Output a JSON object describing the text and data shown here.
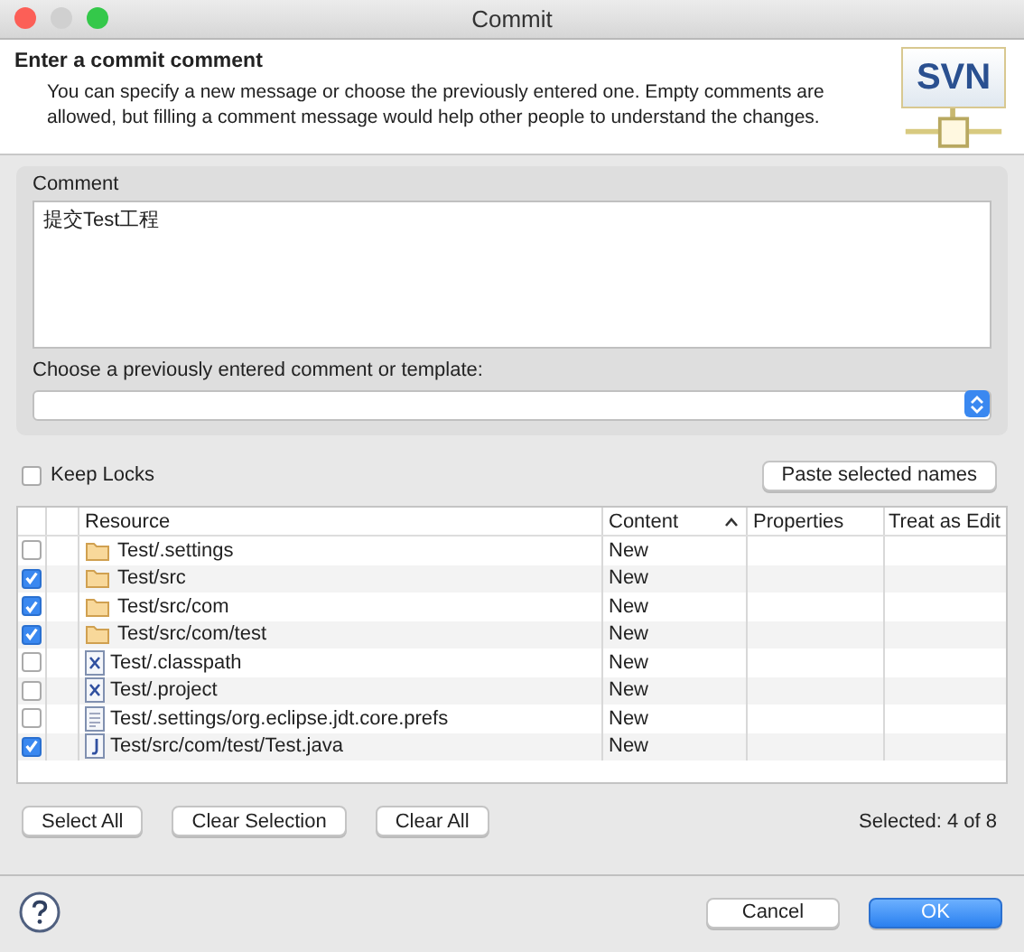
{
  "window": {
    "title": "Commit"
  },
  "header": {
    "title": "Enter a commit comment",
    "description": "You can specify a new message or choose the previously entered one. Empty comments are allowed, but filling a comment message would help other people to understand the changes.",
    "logo": "SVN"
  },
  "comment": {
    "label": "Comment",
    "value": "提交Test工程",
    "template_label": "Choose a previously entered comment or template:"
  },
  "keep_locks": {
    "label": "Keep Locks",
    "checked": false
  },
  "paste_button": "Paste selected names",
  "table": {
    "columns": [
      "Resource",
      "Content",
      "Properties",
      "Treat as Edit"
    ],
    "rows": [
      {
        "kind": "folder",
        "resource": "Test/.settings",
        "content": "New",
        "checked": false
      },
      {
        "kind": "folder",
        "resource": "Test/src",
        "content": "New",
        "checked": true
      },
      {
        "kind": "folder",
        "resource": "Test/src/com",
        "content": "New",
        "checked": true
      },
      {
        "kind": "folder",
        "resource": "Test/src/com/test",
        "content": "New",
        "checked": true
      },
      {
        "kind": "xml",
        "resource": "Test/.classpath",
        "content": "New",
        "checked": false
      },
      {
        "kind": "xml",
        "resource": "Test/.project",
        "content": "New",
        "checked": false
      },
      {
        "kind": "text",
        "resource": "Test/.settings/org.eclipse.jdt.core.prefs",
        "content": "New",
        "checked": false
      },
      {
        "kind": "java",
        "resource": "Test/src/com/test/Test.java",
        "content": "New",
        "checked": true
      }
    ]
  },
  "selection_buttons": [
    "Select All",
    "Clear Selection",
    "Clear All"
  ],
  "selected_count": "Selected: 4 of 8",
  "footer_buttons": [
    {
      "label": "Cancel",
      "kind": "normal"
    },
    {
      "label": "OK",
      "kind": "default"
    }
  ]
}
